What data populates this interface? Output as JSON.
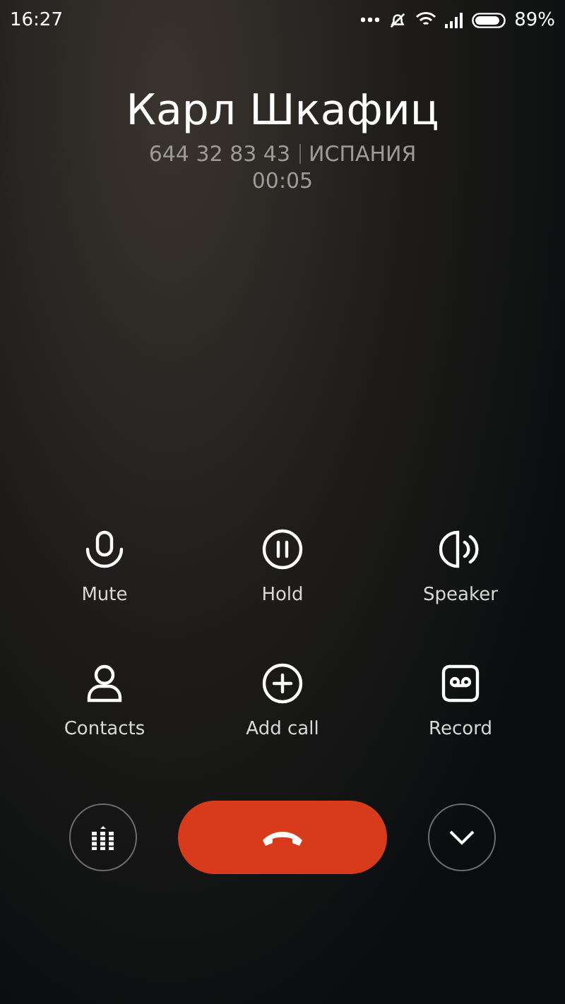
{
  "status_bar": {
    "time": "16:27",
    "battery": "89%"
  },
  "caller": {
    "name": "Карл Шкафиц",
    "number": "644 32 83 43",
    "country": "ИСПАНИЯ",
    "duration": "00:05"
  },
  "actions": [
    {
      "kind": "mute",
      "label": "Mute"
    },
    {
      "kind": "hold",
      "label": "Hold"
    },
    {
      "kind": "speaker",
      "label": "Speaker"
    },
    {
      "kind": "contacts",
      "label": "Contacts"
    },
    {
      "kind": "add",
      "label": "Add call"
    },
    {
      "kind": "record",
      "label": "Record"
    }
  ]
}
